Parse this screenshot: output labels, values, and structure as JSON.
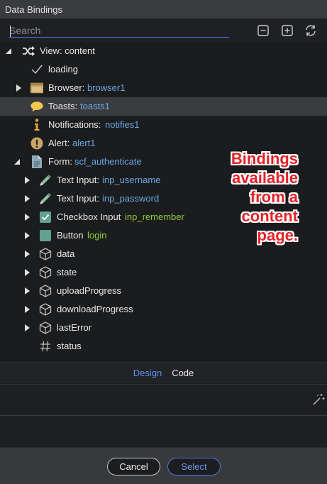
{
  "window": {
    "title": "Data Bindings"
  },
  "search": {
    "placeholder": "Search"
  },
  "toolbar": {
    "collapse_icon": "minus-square-icon",
    "expand_icon": "plus-square-icon",
    "refresh_icon": "refresh-icon"
  },
  "tree": {
    "root": {
      "label": "View: content",
      "icon": "shuffle-icon"
    },
    "loading": {
      "label": "loading",
      "icon": "check-icon"
    },
    "browser": {
      "label": "Browser:",
      "value": "browser1"
    },
    "toasts": {
      "label": "Toasts:",
      "value": "toasts1"
    },
    "notifications": {
      "label": "Notifications:",
      "value": "notifies1"
    },
    "alert": {
      "label": "Alert:",
      "value": "alert1"
    },
    "form": {
      "label": "Form:",
      "value": "scf_authenticate"
    },
    "text_input_1": {
      "label": "Text Input:",
      "value": "inp_username"
    },
    "text_input_2": {
      "label": "Text Input:",
      "value": "inp_password"
    },
    "checkbox": {
      "label": "Checkbox Input",
      "value": "inp_remember"
    },
    "button": {
      "label": "Button",
      "value": "login"
    },
    "data": {
      "label": "data"
    },
    "state": {
      "label": "state"
    },
    "upload": {
      "label": "uploadProgress"
    },
    "download": {
      "label": "downloadProgress"
    },
    "last_error": {
      "label": "lastError"
    },
    "status": {
      "label": "status"
    }
  },
  "annotation": {
    "lines": [
      "Bindings",
      "available",
      "from a",
      "content",
      "page."
    ]
  },
  "tabs": {
    "design": "Design",
    "code": "Code"
  },
  "footer": {
    "cancel": "Cancel",
    "select": "Select"
  },
  "colors": {
    "accent": "#4f78e6",
    "value_blue": "#6aa8e6",
    "value_green": "#8fcf3c",
    "annotation_red": "#e32228"
  }
}
